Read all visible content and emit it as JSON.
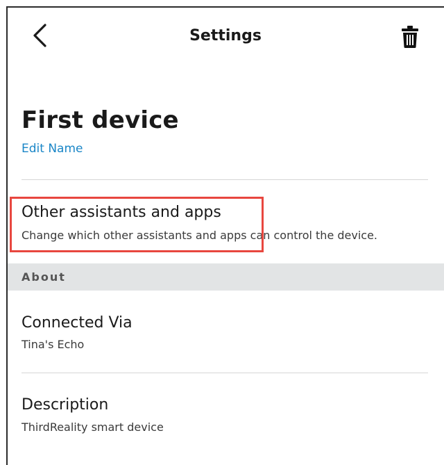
{
  "header": {
    "title": "Settings",
    "back_icon": "chevron-left-icon",
    "delete_icon": "trash-icon"
  },
  "device": {
    "name": "First device",
    "edit_label": "Edit Name"
  },
  "other_assistants": {
    "title": "Other assistants and apps",
    "subtitle": "Change which other assistants and apps can control the device."
  },
  "about_section": {
    "label": "About"
  },
  "connected_via": {
    "title": "Connected Via",
    "value": "Tina's Echo"
  },
  "description": {
    "title": "Description",
    "value": "ThirdReality smart device"
  },
  "colors": {
    "link": "#1a86c7",
    "highlight": "#e8473f",
    "section_bg": "#e2e4e5"
  }
}
